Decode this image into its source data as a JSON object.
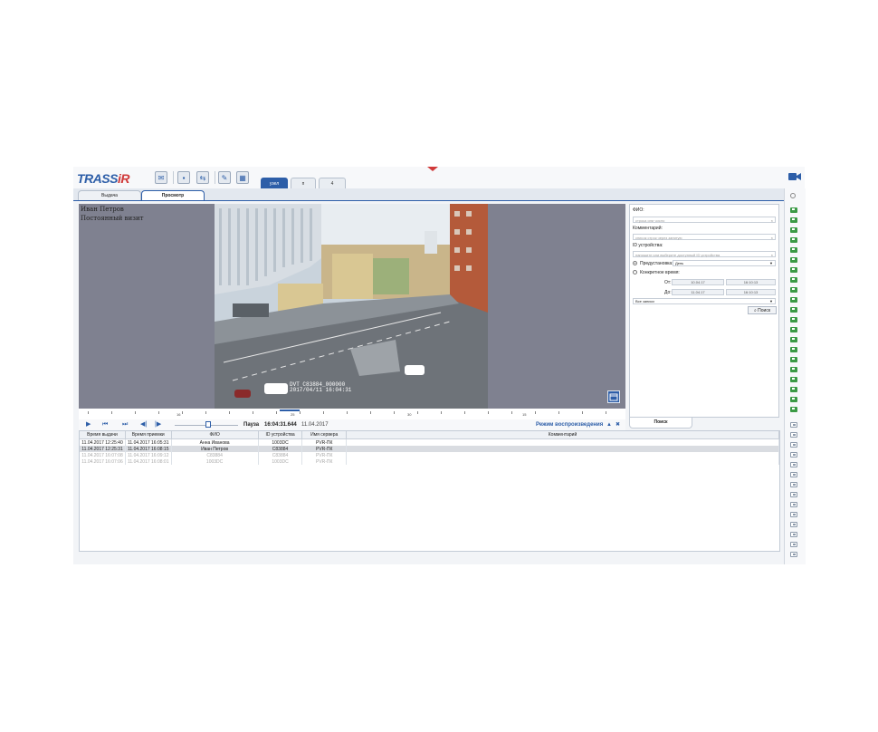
{
  "app": {
    "logo_main": "TRASS",
    "logo_accent": "iR",
    "window_tabs": [
      "узел",
      "п",
      "4"
    ],
    "sub_tabs": [
      "Выдача",
      "Просмотр"
    ],
    "active_sub_tab": "Просмотр",
    "colors": {
      "accent": "#2d5ea8",
      "online": "#3b9a45",
      "logo_red": "#d03a3a"
    }
  },
  "video": {
    "overlay_name": "Иван Петров",
    "overlay_status": "Постоянный визит",
    "stamp_line1": "DVT C83884_000000",
    "stamp_line2": "2017/04/11 16:04:31"
  },
  "timeline": {
    "labels": [
      "16",
      "25",
      "30",
      "15"
    ]
  },
  "playback": {
    "state": "Пауза",
    "time": "16:04:31.644",
    "date": "11.04.2017",
    "mode": "Режим воспроизведения"
  },
  "search": {
    "fio_label": "ФИО:",
    "fio_placeholder": "строка или число",
    "comment_label": "Комментарий:",
    "comment_placeholder": "список строк через запятую",
    "device_label": "ID устройства:",
    "device_placeholder": "напишите или выберите доступный ID устройства",
    "preset_label": "Предустановка:",
    "preset_value": "День",
    "specific_label": "Конкретное время:",
    "from_label": "От:",
    "to_label": "До:",
    "from_date": "10.04.17",
    "from_time": "16:10:13",
    "to_date": "11.04.17",
    "to_time": "16:10:13",
    "records_value": "Все записи",
    "search_button": "Поиск",
    "panel_tab": "Поиск"
  },
  "table": {
    "columns": [
      "Время выдачи",
      "Время приемки",
      "ФИО",
      "ID устройства",
      "Имя сервера",
      "Комментарий"
    ],
    "rows": [
      [
        "11.04.2017 12:25:40",
        "11.04.2017 16:05:31",
        "Анна Иванова",
        "1003DC",
        "PVR-ПК",
        ""
      ],
      [
        "11.04.2017 12:25:31",
        "11.04.2017 16:08:15",
        "Иван Петров",
        "C83884",
        "PVR-ПК",
        ""
      ],
      [
        "11.04.2017 16:07:08",
        "11.04.2017 16:09:12",
        "C83884",
        "C83884",
        "PVR-ПК",
        ""
      ],
      [
        "11.04.2017 16:07:06",
        "11.04.2017 16:08:01",
        "1003DC",
        "1003DC",
        "PVR-ПК",
        ""
      ]
    ]
  }
}
